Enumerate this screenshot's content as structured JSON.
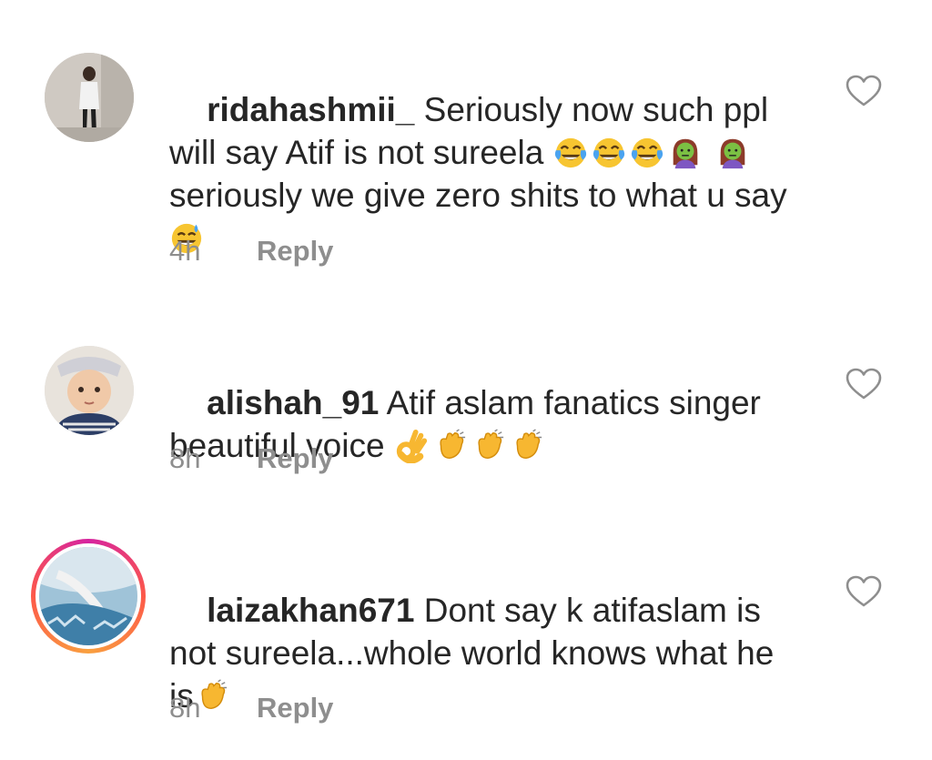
{
  "comments": [
    {
      "username": "ridahashmii_",
      "text_parts": [
        " Seriously now such ppl will say Atif is not sureela ",
        " seriously we give zero shits to what u say "
      ],
      "time": "4h",
      "reply_label": "Reply",
      "emoji_names": [
        "tears-of-joy-emoji",
        "tears-of-joy-emoji",
        "tears-of-joy-emoji",
        "zombie-woman-emoji",
        "zombie-woman-emoji",
        "sweat-smile-emoji"
      ]
    },
    {
      "username": "alishah_91",
      "text_parts": [
        " Atif aslam fanatics singer beautiful voice "
      ],
      "time": "8h",
      "reply_label": "Reply",
      "emoji_names": [
        "ok-hand-emoji",
        "clapping-hands-emoji",
        "clapping-hands-emoji",
        "clapping-hands-emoji"
      ]
    },
    {
      "username": "laizakhan671",
      "text_parts": [
        " Dont say k atifaslam is not sureela...whole world knows what he is"
      ],
      "time": "8h",
      "reply_label": "Reply",
      "emoji_names": [
        "clapping-hands-emoji"
      ],
      "has_story_ring": true
    }
  ],
  "colors": {
    "text": "#262626",
    "meta": "#8e8e8e",
    "heart": "#8e8e8e"
  },
  "icons": {
    "like": "heart-outline-icon"
  }
}
